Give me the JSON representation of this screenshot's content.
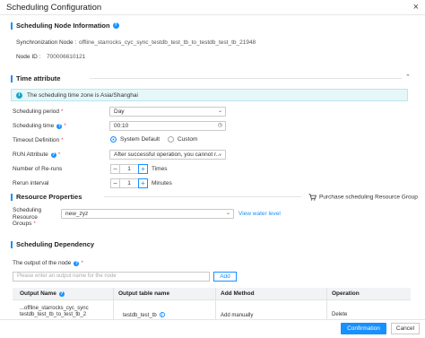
{
  "window": {
    "title": "Scheduling Configuration",
    "close": "×"
  },
  "node_info": {
    "title": "Scheduling Node Information",
    "sync_label": "Synchronization Node :",
    "sync_value": "offline_starrocks_cyc_sync_testdb_test_tb_to_testdb_test_tb_21948",
    "node_id_label": "Node ID :",
    "node_id_value": "700006610121"
  },
  "time_attribute": {
    "title": "Time attribute",
    "banner": "The scheduling time zone is Asia/Shanghai",
    "period_label": "Scheduling period",
    "period_value": "Day",
    "time_label": "Scheduling time",
    "time_value": "00:10",
    "timeout_label": "Timeout Definition",
    "timeout_options": [
      "System Default",
      "Custom"
    ],
    "run_label": "RUN Attribute",
    "run_value": "After successful operation, you cannot r...",
    "reruns_label": "Number of Re-runs",
    "reruns_value": "1",
    "reruns_unit": "Times",
    "rerun_interval_label": "Rerun interval",
    "rerun_interval_value": "1",
    "rerun_interval_unit": "Minutes"
  },
  "resource": {
    "title": "Resource Properties",
    "purchase": "Purchase scheduling Resource Group",
    "group_label": "Scheduling Resource Groups",
    "group_value": "new_zyz",
    "view_link": "View water level"
  },
  "dependency": {
    "title": "Scheduling Dependency",
    "output_label": "The output of the node",
    "input_placeholder": "Please enter an output name for the node",
    "add_button": "Add",
    "columns": [
      "Output Name",
      "Output table name",
      "Add Method",
      "Operation"
    ],
    "rows": [
      {
        "output_name_1": "...offline_starrocks_cyc_sync",
        "output_name_2": "testdb_test_tb_to_test_tb_2",
        "table": "testdb_test_tb",
        "method": "Add manually",
        "operation": "Delete"
      }
    ]
  },
  "footer": {
    "confirm": "Confirmation",
    "cancel": "Cancel"
  },
  "colors": {
    "accent": "#1890ff",
    "banner_bg": "#e6f7fa",
    "required": "#e34d59"
  }
}
